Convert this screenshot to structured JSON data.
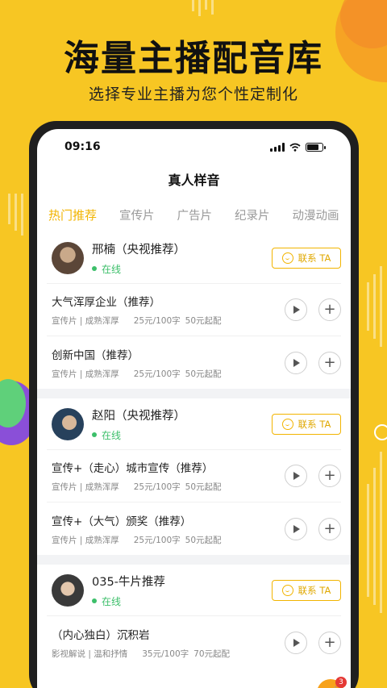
{
  "hero": {
    "title": "海量主播配音库",
    "subtitle": "选择专业主播为您个性定制化"
  },
  "status_bar": {
    "time": "09:16"
  },
  "page": {
    "title": "真人样音"
  },
  "tabs": [
    {
      "label": "热门推荐",
      "active": true
    },
    {
      "label": "宣传片",
      "active": false
    },
    {
      "label": "广告片",
      "active": false
    },
    {
      "label": "纪录片",
      "active": false
    },
    {
      "label": "动漫动画",
      "active": false
    }
  ],
  "anchors": [
    {
      "name": "邢楠（央视推荐）",
      "status": "在线",
      "contact_label": "联系 TA",
      "samples": [
        {
          "title": "大气浑厚企业（推荐）",
          "category": "宣传片 | 成熟浑厚",
          "price": "25元/100字",
          "start": "50元起配"
        },
        {
          "title": "创新中国（推荐）",
          "category": "宣传片 | 成熟浑厚",
          "price": "25元/100字",
          "start": "50元起配"
        }
      ]
    },
    {
      "name": "赵阳（央视推荐）",
      "status": "在线",
      "contact_label": "联系 TA",
      "samples": [
        {
          "title": "宣传+（走心）城市宣传（推荐）",
          "category": "宣传片 | 成熟浑厚",
          "price": "25元/100字",
          "start": "50元起配"
        },
        {
          "title": "宣传+（大气）颁奖（推荐）",
          "category": "宣传片 | 成熟浑厚",
          "price": "25元/100字",
          "start": "50元起配"
        }
      ]
    },
    {
      "name": "035-牛片推荐",
      "status": "在线",
      "contact_label": "联系 TA",
      "samples": [
        {
          "title": "（内心独白）沉积岩",
          "category": "影视解说 | 温和抒情",
          "price": "35元/100字",
          "start": "70元起配"
        }
      ]
    }
  ],
  "cart": {
    "badge": "3"
  },
  "colors": {
    "accent": "#F2B400",
    "background": "#F7C623",
    "online": "#3cbf6a"
  }
}
